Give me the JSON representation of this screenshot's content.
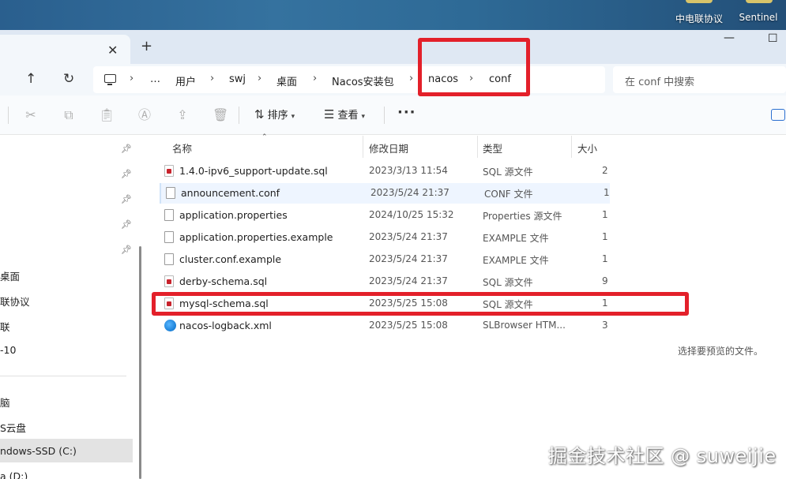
{
  "desktop": {
    "icons": [
      {
        "label": "中电联协议"
      },
      {
        "label": "Sentinel"
      }
    ]
  },
  "tabs": {
    "close_glyph": "✕",
    "new_tab_glyph": "+"
  },
  "window_controls": {
    "minimize": "—",
    "maximize": "☐"
  },
  "address": {
    "up_glyph": "↑",
    "refresh_glyph": "↻",
    "crumbs": [
      "…",
      "用户",
      "swj",
      "桌面",
      "Nacos安装包",
      "nacos",
      "conf"
    ],
    "separator": "›"
  },
  "search": {
    "placeholder": "在 conf 中搜索"
  },
  "toolbar": {
    "sort_label": "排序",
    "view_label": "查看",
    "more_label": "···"
  },
  "navpane": {
    "items": [
      {
        "label": "桌面"
      },
      {
        "label": "联协议"
      },
      {
        "label": "联"
      },
      {
        "label": "-10"
      },
      {
        "label": "脑"
      },
      {
        "label": "S云盘"
      },
      {
        "label": "ndows-SSD (C:)"
      },
      {
        "label": "a (D:)"
      }
    ],
    "selected": "ndows-SSD (C:)"
  },
  "list": {
    "columns": {
      "name": "名称",
      "modified": "修改日期",
      "type": "类型",
      "size": "大小"
    },
    "rows": [
      {
        "icon": "sql-file-icon",
        "name": "1.4.0-ipv6_support-update.sql",
        "modified": "2023/3/13 11:54",
        "type": "SQL 源文件",
        "size": "2"
      },
      {
        "icon": "file-icon",
        "name": "announcement.conf",
        "modified": "2023/5/24 21:37",
        "type": "CONF 文件",
        "size": "1"
      },
      {
        "icon": "file-icon",
        "name": "application.properties",
        "modified": "2024/10/25 15:32",
        "type": "Properties 源文件",
        "size": "1"
      },
      {
        "icon": "file-icon",
        "name": "application.properties.example",
        "modified": "2023/5/24 21:37",
        "type": "EXAMPLE 文件",
        "size": "1"
      },
      {
        "icon": "file-icon",
        "name": "cluster.conf.example",
        "modified": "2023/5/24 21:37",
        "type": "EXAMPLE 文件",
        "size": "1"
      },
      {
        "icon": "sql-file-icon",
        "name": "derby-schema.sql",
        "modified": "2023/5/24 21:37",
        "type": "SQL 源文件",
        "size": "9"
      },
      {
        "icon": "sql-file-icon",
        "name": "mysql-schema.sql",
        "modified": "2023/5/25 15:08",
        "type": "SQL 源文件",
        "size": "1"
      },
      {
        "icon": "browser-file-icon",
        "name": "nacos-logback.xml",
        "modified": "2023/5/25 15:08",
        "type": "SLBrowser HTM...",
        "size": "3"
      }
    ],
    "selected_row": "announcement.conf"
  },
  "preview": {
    "message": "选择要预览的文件。"
  },
  "watermark": {
    "text": "掘金技术社区 @ suweijie"
  },
  "colors": {
    "annotation_red": "#e3202a",
    "accent_blue": "#2b6fd0",
    "selection": "#eef5ff"
  }
}
